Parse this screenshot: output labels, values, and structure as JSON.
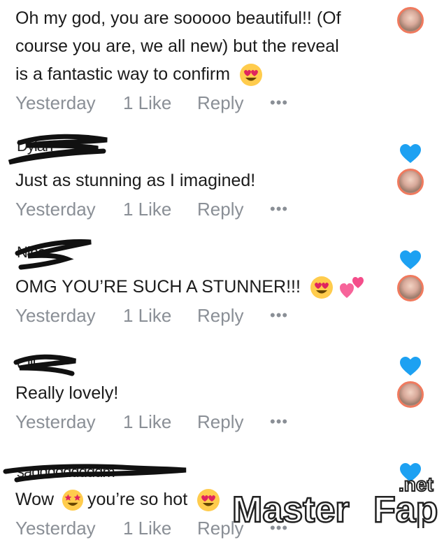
{
  "comments": [
    {
      "author": "",
      "lines": [
        "Oh my god, you are sooooo beautiful!! (Of",
        "course you are, we all new) but the reveal",
        "is a fantastic way to confirm"
      ],
      "emoji": "heart-eyes-emoji",
      "time": "Yesterday",
      "likes": "1 Like",
      "reply": "Reply",
      "more": "•••"
    },
    {
      "author": "Dylan",
      "lines": [
        "Just as stunning as I imagined!"
      ],
      "time": "Yesterday",
      "likes": "1 Like",
      "reply": "Reply",
      "more": "•••"
    },
    {
      "author": "Nina",
      "lines": [
        "OMG YOU’RE SUCH A STUNNER!!!"
      ],
      "emoji": "heart-eyes-emoji",
      "emoji2": "two-hearts-emoji",
      "time": "Yesterday",
      "likes": "1 Like",
      "reply": "Reply",
      "more": "•••"
    },
    {
      "author": "Cill",
      "lines": [
        "Really lovely!"
      ],
      "time": "Yesterday",
      "likes": "1 Like",
      "reply": "Reply",
      "more": "•••"
    },
    {
      "author": "sadddddddddm",
      "lines": [
        "Wow",
        "you’re so hot"
      ],
      "time": "Yesterday",
      "likes": "1 Like",
      "reply": "Reply",
      "more": "•••"
    }
  ],
  "watermark": {
    "brand_left": "Master",
    "brand_right": "Fap",
    "tld": ".net"
  },
  "colors": {
    "heart": "#1da1f2",
    "avatar_ring": "#f07a5e",
    "meta_text": "#8a8f96"
  }
}
